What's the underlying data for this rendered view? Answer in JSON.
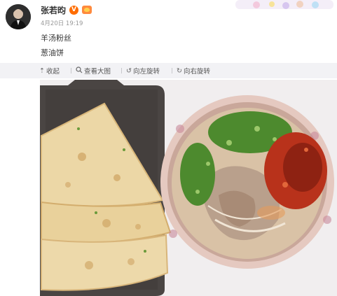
{
  "user": {
    "name": "张若昀",
    "avatar_icon": "user-avatar",
    "verified_icon": "verified-v-badge",
    "level_icon": "vip-level-badge"
  },
  "post": {
    "timestamp": "4月20日 19:19",
    "lines": [
      "羊汤粉丝",
      "葱油饼"
    ]
  },
  "toolbar": {
    "collapse_label": "收起",
    "view_large_label": "查看大图",
    "rotate_left_label": "向左旋转",
    "rotate_right_label": "向右旋转",
    "collapse_icon": "arrow-up-icon",
    "view_large_icon": "zoom-in-icon",
    "rotate_left_icon": "rotate-left-icon",
    "rotate_right_icon": "rotate-right-icon"
  },
  "photo": {
    "subject": "scallion pancakes on a dark plate and a bowl of mutton soup vermicelli with chili oil",
    "colors": {
      "background": "#f1eeef",
      "plate": "#4a4543",
      "pancake": "#ecd7a6",
      "broth": "#d9c2a6",
      "bowl_rim": "#e5c9c0",
      "scallion": "#4d8a2e",
      "chili": "#b8321b"
    }
  }
}
